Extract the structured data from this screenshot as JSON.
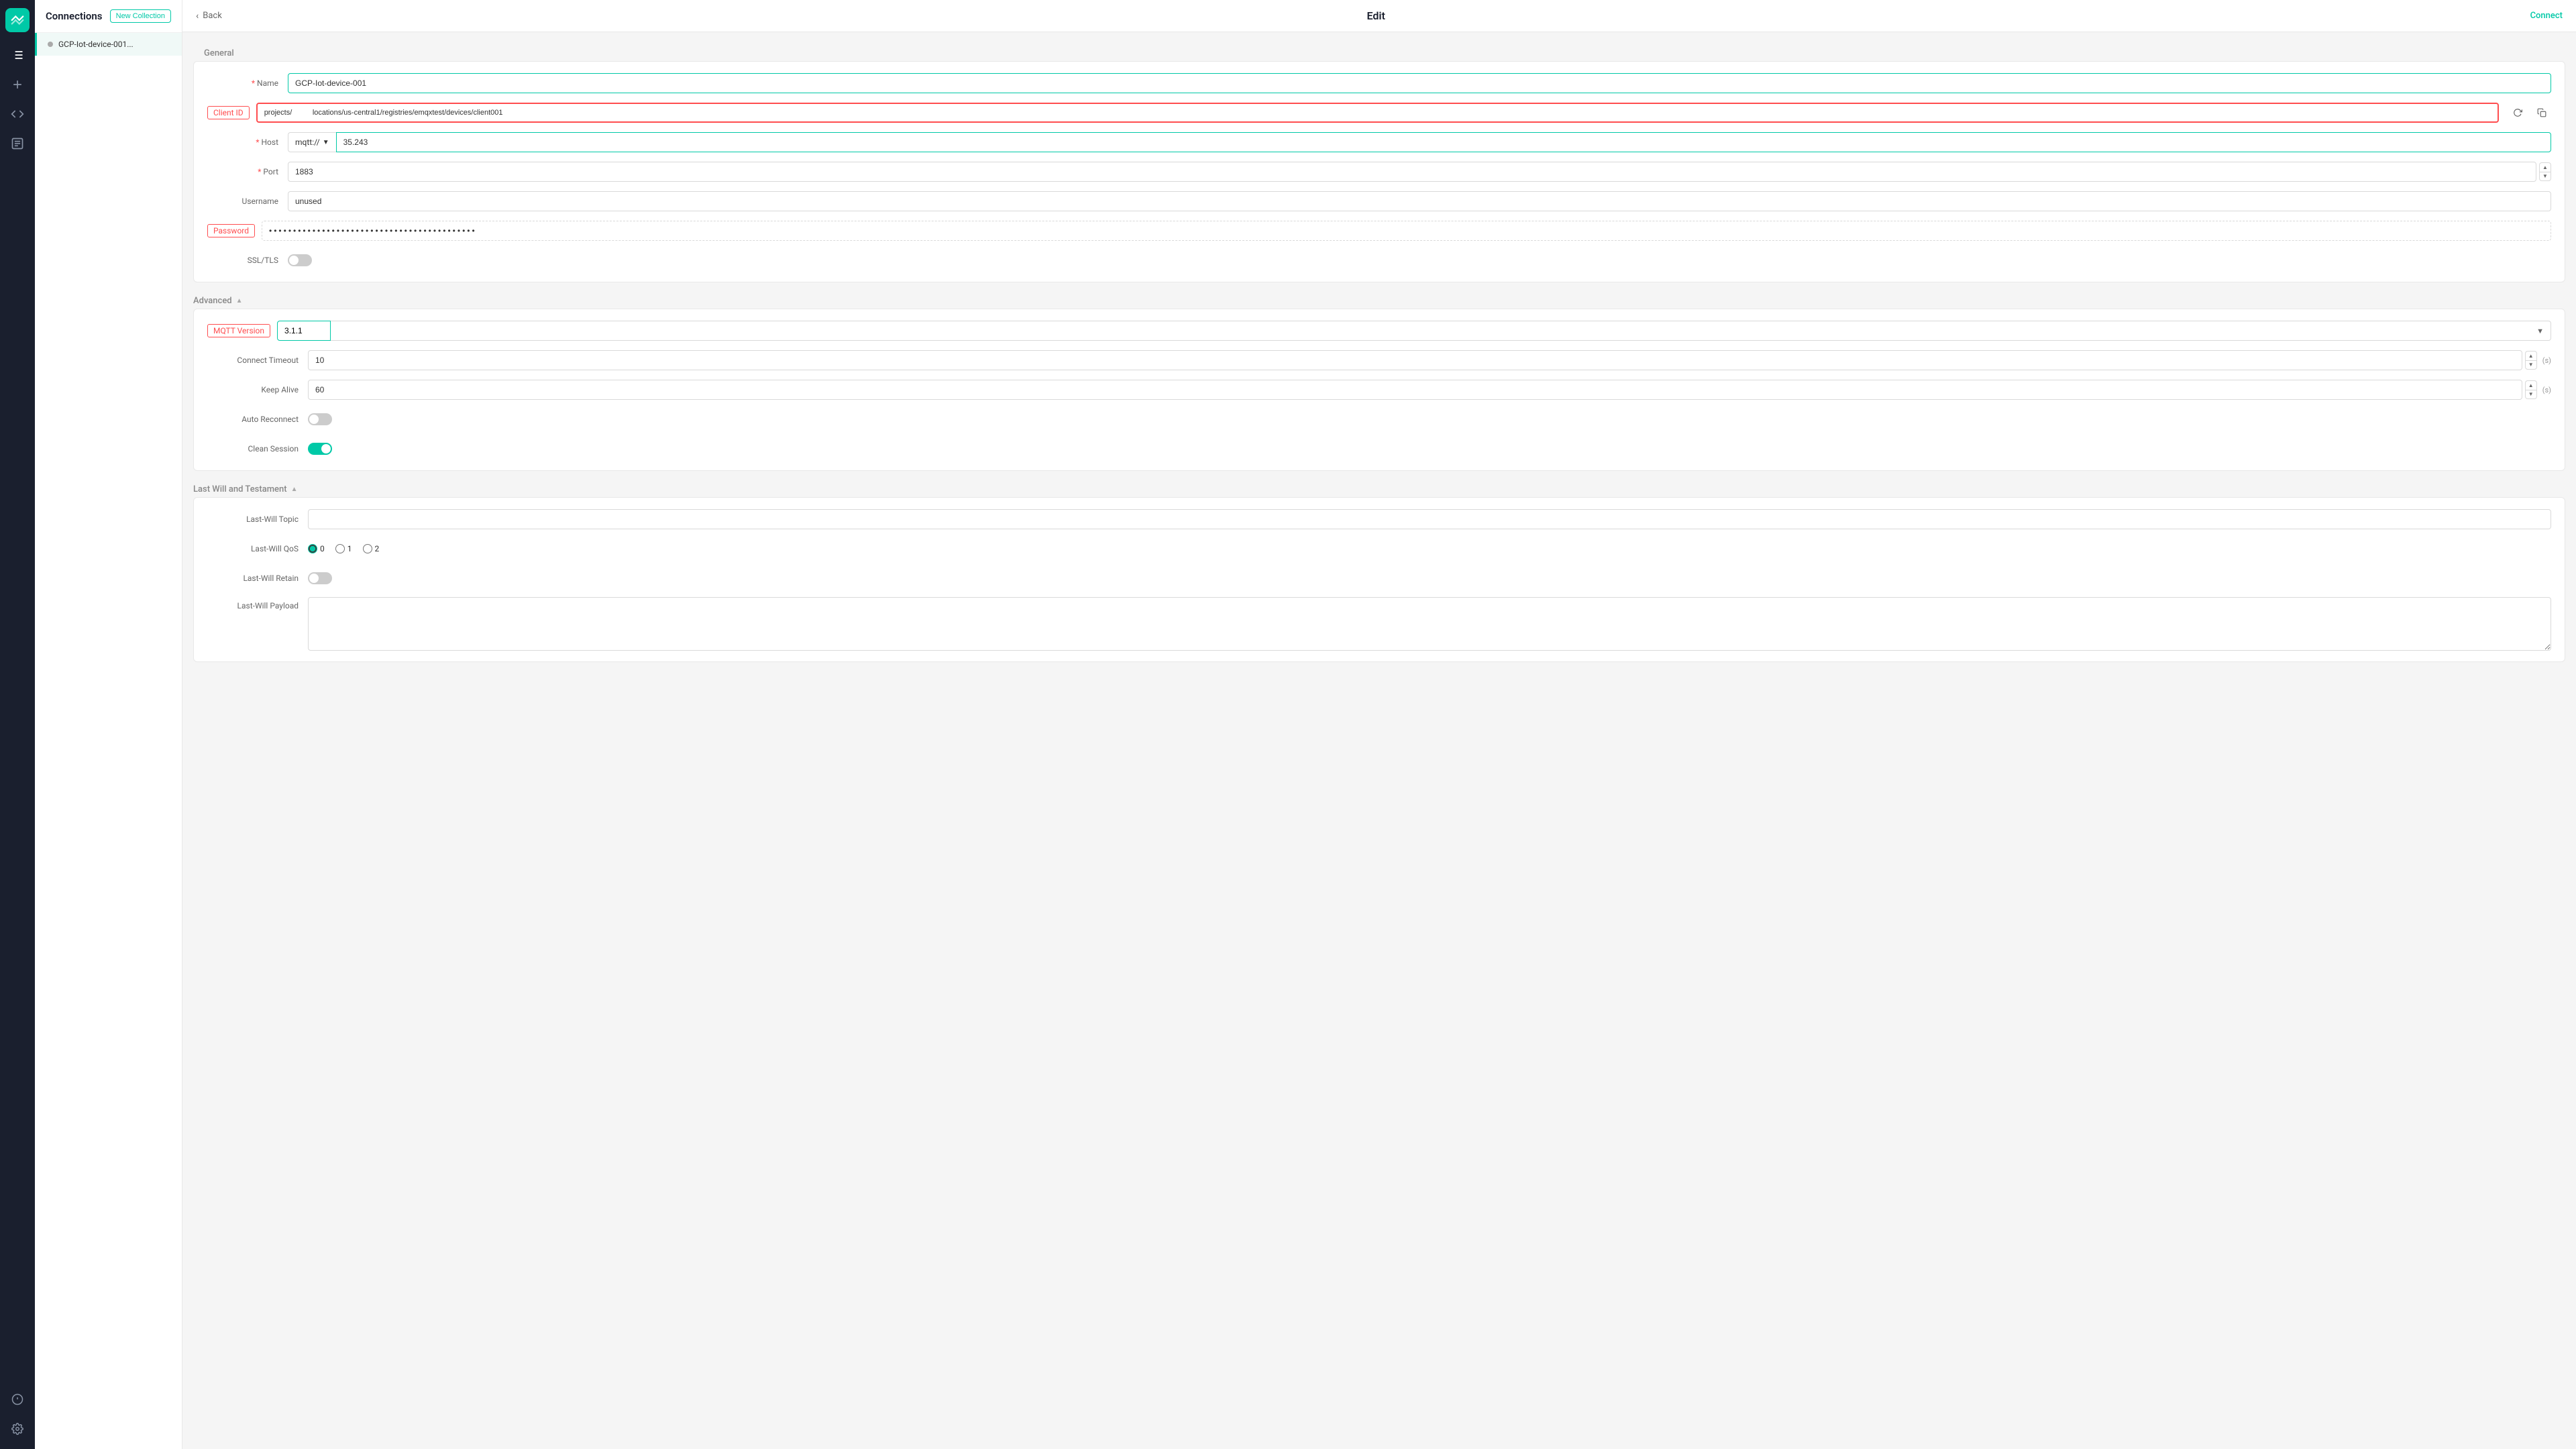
{
  "sidebar": {
    "logo_alt": "MQTTX Logo",
    "icons": [
      {
        "name": "connections-icon",
        "label": "Connections",
        "active": true,
        "symbol": "⇌"
      },
      {
        "name": "add-icon",
        "label": "New Connection",
        "symbol": "+"
      },
      {
        "name": "code-icon",
        "label": "Script",
        "symbol": "</>"
      },
      {
        "name": "log-icon",
        "label": "Log",
        "symbol": "≡"
      },
      {
        "name": "info-icon",
        "label": "About",
        "symbol": "ⓘ"
      },
      {
        "name": "settings-icon",
        "label": "Settings",
        "symbol": "⚙"
      }
    ]
  },
  "left_panel": {
    "title": "Connections",
    "new_collection_label": "New Collection",
    "connections": [
      {
        "name": "GCP-Iot-device-001...",
        "dot_color": "#aaa"
      }
    ]
  },
  "topbar": {
    "back_label": "Back",
    "title": "Edit",
    "connect_label": "Connect"
  },
  "general_section": {
    "title": "General",
    "fields": {
      "name_label": "Name",
      "name_value": "GCP-Iot-device-001",
      "client_id_label": "Client ID",
      "client_id_value": "projects/        locations/us-central1/registries/emqxtest/devices/client001",
      "host_label": "Host",
      "host_protocol": "mqtt://",
      "host_ip": "35.243",
      "port_label": "Port",
      "port_value": "1883",
      "username_label": "Username",
      "username_value": "unused",
      "password_label": "Password",
      "password_value": "••••••••••••••••••••••••••••••••••••••••••••••••••••••••••••••",
      "ssl_label": "SSL/TLS",
      "ssl_enabled": false
    }
  },
  "advanced_section": {
    "title": "Advanced",
    "fields": {
      "mqtt_version_label": "MQTT Version",
      "mqtt_version_value": "3.1.1",
      "connect_timeout_label": "Connect Timeout",
      "connect_timeout_value": "10",
      "connect_timeout_unit": "(s)",
      "keep_alive_label": "Keep Alive",
      "keep_alive_value": "60",
      "keep_alive_unit": "(s)",
      "auto_reconnect_label": "Auto Reconnect",
      "auto_reconnect_enabled": false,
      "clean_session_label": "Clean Session",
      "clean_session_enabled": true
    }
  },
  "last_will_section": {
    "title": "Last Will and Testament",
    "fields": {
      "topic_label": "Last-Will Topic",
      "topic_value": "",
      "qos_label": "Last-Will QoS",
      "qos_options": [
        "0",
        "1",
        "2"
      ],
      "qos_selected": "0",
      "retain_label": "Last-Will Retain",
      "retain_enabled": false,
      "payload_label": "Last-Will Payload",
      "payload_value": ""
    }
  }
}
